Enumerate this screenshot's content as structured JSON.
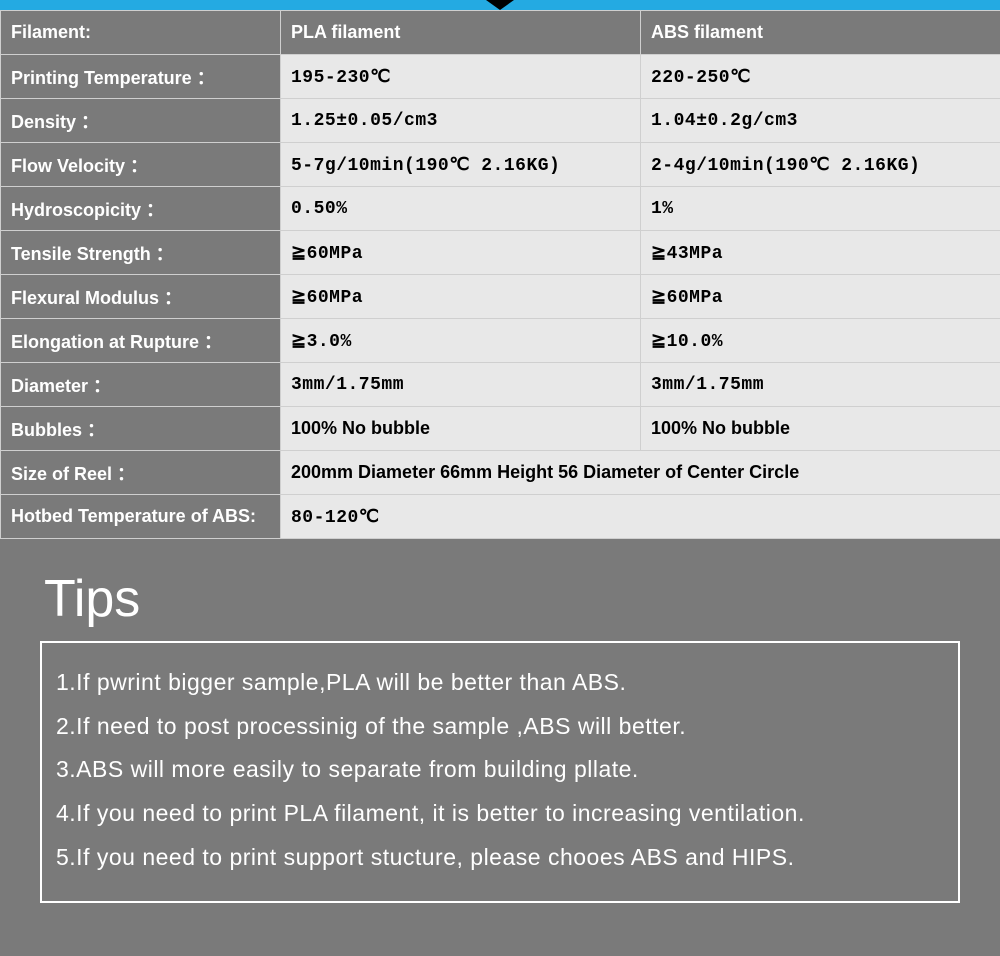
{
  "table": {
    "header": {
      "label": "Filament:",
      "col_pla": "PLA filament",
      "col_abs": "ABS filament"
    },
    "rows": [
      {
        "label": "Printing Temperature ：",
        "pla": "195-230℃",
        "abs": "220-250℃",
        "mono": true
      },
      {
        "label": "Density ：",
        "pla": "1.25±0.05/cm3",
        "abs": "1.04±0.2g/cm3",
        "mono": true
      },
      {
        "label": "Flow Velocity ：",
        "pla": "5-7g/10min(190℃ 2.16KG)",
        "abs": "2-4g/10min(190℃ 2.16KG)",
        "mono": true
      },
      {
        "label": "Hydroscopicity ：",
        "pla": "0.50%",
        "abs": "1%",
        "mono": true
      },
      {
        "label": "Tensile Strength ：",
        "pla": "≧60MPa",
        "abs": "≧43MPa",
        "mono": true
      },
      {
        "label": "Flexural Modulus ：",
        "pla": "≧60MPa",
        "abs": "≧60MPa",
        "mono": true
      },
      {
        "label": "Elongation at Rupture ：",
        "pla": "≧3.0%",
        "abs": "≧10.0%",
        "mono": true
      },
      {
        "label": "Diameter ：",
        "pla": "3mm/1.75mm",
        "abs": "3mm/1.75mm",
        "mono": true
      },
      {
        "label": "Bubbles ：",
        "pla": "100% No bubble",
        "abs": "100% No bubble",
        "mono": false
      }
    ],
    "spanrows": [
      {
        "label": "Size of Reel ：",
        "value": "200mm Diameter  66mm Height    56 Diameter of Center Circle",
        "mono": false
      },
      {
        "label": "Hotbed Temperature of ABS:",
        "value": "80-120℃",
        "mono": true
      }
    ]
  },
  "tips": {
    "title": "Tips",
    "lines": [
      "1.If pwrint bigger sample,PLA will be better than ABS.",
      "2.If need to post processinig of the sample ,ABS will better.",
      "3.ABS will more easily to separate from building pllate.",
      "4.If you need to print PLA filament, it is better to increasing ventilation.",
      "5.If you need to print support stucture, please chooes ABS and HIPS."
    ]
  }
}
